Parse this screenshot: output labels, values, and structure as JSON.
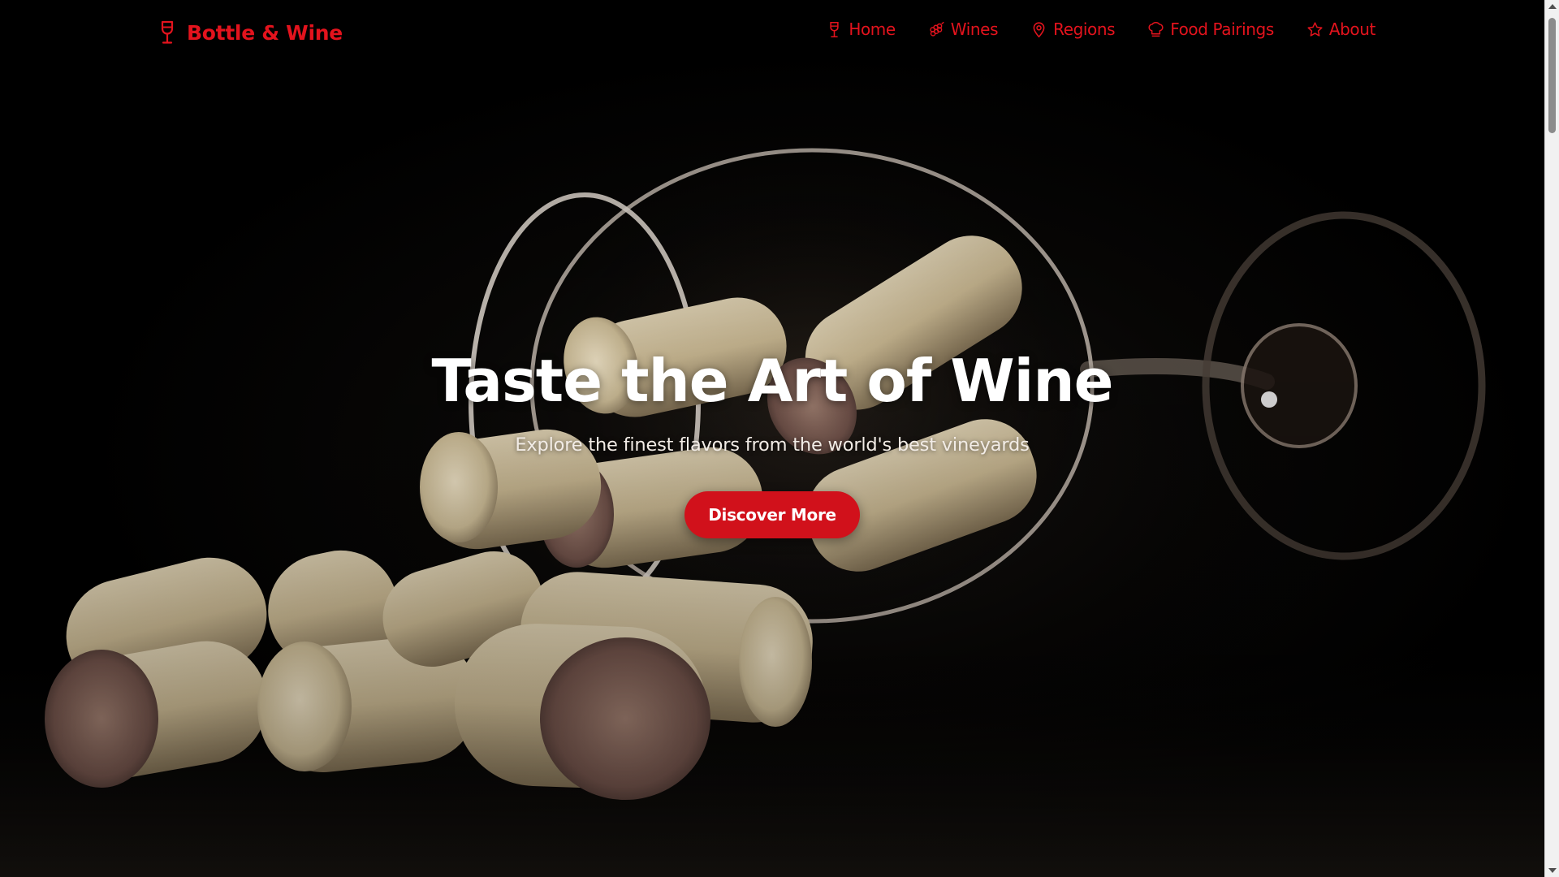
{
  "brand": {
    "name": "Bottle & Wine",
    "icon": "wine-glass-icon",
    "color": "#e3131d"
  },
  "nav": {
    "items": [
      {
        "label": "Home",
        "icon": "wine-glass-icon"
      },
      {
        "label": "Wines",
        "icon": "grapes-icon"
      },
      {
        "label": "Regions",
        "icon": "map-pin-icon"
      },
      {
        "label": "Food Pairings",
        "icon": "chef-hat-icon"
      },
      {
        "label": "About",
        "icon": "star-icon"
      }
    ]
  },
  "hero": {
    "title": "Taste the Art of Wine",
    "subtitle": "Explore the finest flavors from the world's best vineyards",
    "cta_label": "Discover More",
    "background": "photo-wine-glass-with-corks",
    "cta_color": "#d1111b"
  }
}
